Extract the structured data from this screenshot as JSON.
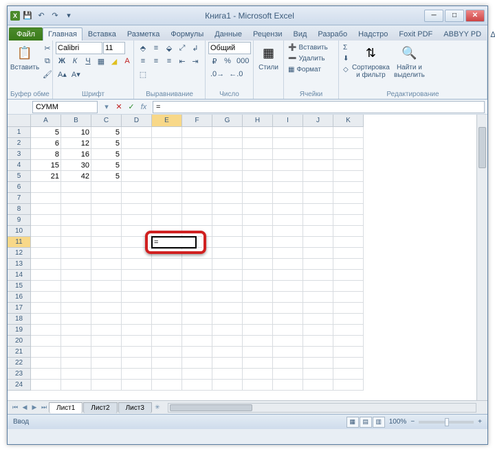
{
  "title": "Книга1 - Microsoft Excel",
  "menu": {
    "file": "Файл",
    "tabs": [
      "Главная",
      "Вставка",
      "Разметка",
      "Формулы",
      "Данные",
      "Рецензи",
      "Вид",
      "Разрабо",
      "Надстро",
      "Foxit PDF",
      "ABBYY PD"
    ]
  },
  "ribbon": {
    "clipboard": {
      "paste": "Вставить",
      "label": "Буфер обмена"
    },
    "font": {
      "name": "Calibri",
      "size": "11",
      "label": "Шрифт"
    },
    "align": {
      "label": "Выравнивание"
    },
    "number": {
      "format": "Общий",
      "label": "Число"
    },
    "styles": {
      "btn": "Стили",
      "label": ""
    },
    "cells": {
      "insert": "Вставить",
      "delete": "Удалить",
      "format": "Формат",
      "label": "Ячейки"
    },
    "editing": {
      "sort": "Сортировка и фильтр",
      "find": "Найти и выделить",
      "label": "Редактирование"
    }
  },
  "formula_bar": {
    "name_box": "СУММ",
    "formula": "="
  },
  "columns": [
    "A",
    "B",
    "C",
    "D",
    "E",
    "F",
    "G",
    "H",
    "I",
    "J",
    "K"
  ],
  "row_count": 24,
  "active_col": 4,
  "active_row": 11,
  "cell_data": {
    "A": [
      5,
      6,
      8,
      15,
      21
    ],
    "B": [
      10,
      12,
      16,
      30,
      42
    ],
    "C": [
      5,
      5,
      5,
      5,
      5
    ]
  },
  "editing_cell": {
    "col": 4,
    "row": 11,
    "value": "="
  },
  "sheets": {
    "active": "Лист1",
    "others": [
      "Лист2",
      "Лист3"
    ]
  },
  "status": {
    "mode": "Ввод",
    "zoom": "100%"
  }
}
